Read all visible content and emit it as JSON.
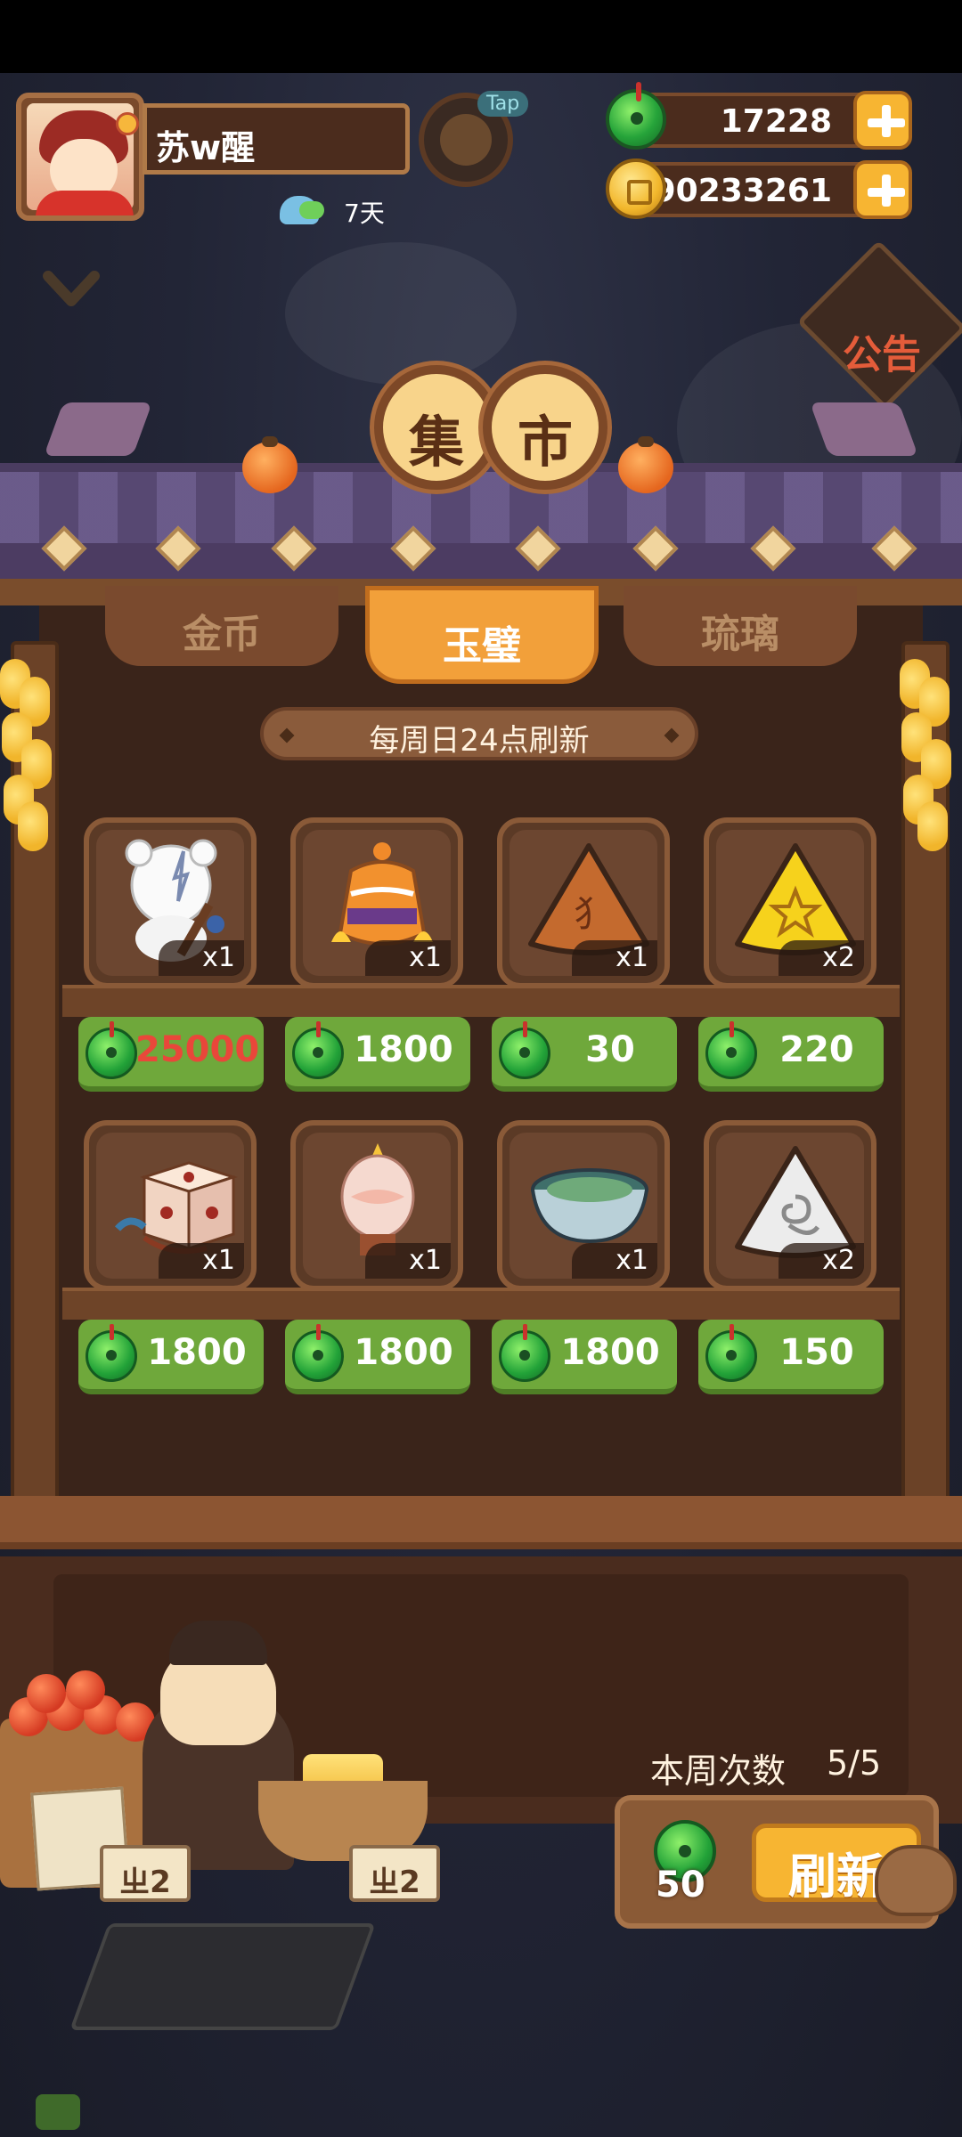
{
  "player": {
    "name": "苏w醒",
    "days": "7天",
    "tap_label": "Tap"
  },
  "currency": {
    "jade": "17228",
    "coins": "90233261"
  },
  "notice": {
    "label": "公告"
  },
  "market": {
    "title_chars": [
      "集",
      "市"
    ],
    "tabs": [
      {
        "label": "金币",
        "active": false
      },
      {
        "label": "玉璧",
        "active": true
      },
      {
        "label": "琉璃",
        "active": false
      }
    ],
    "refresh_note": "每周日24点刷新",
    "items": [
      {
        "icon": "bear-musician-icon",
        "qty": "x1",
        "price": "25000",
        "price_color": "#e9473a"
      },
      {
        "icon": "ornate-jar-icon",
        "qty": "x1",
        "price": "1800"
      },
      {
        "icon": "copper-rice-dumpling-icon",
        "qty": "x1",
        "price": "30"
      },
      {
        "icon": "gold-star-dumpling-icon",
        "qty": "x2",
        "price": "220"
      },
      {
        "icon": "dice-block-icon",
        "qty": "x1",
        "price": "1800"
      },
      {
        "icon": "lantern-icon",
        "qty": "x1",
        "price": "1800"
      },
      {
        "icon": "jade-bowl-icon",
        "qty": "x1",
        "price": "1800"
      },
      {
        "icon": "silver-swirl-dumpling-icon",
        "qty": "x2",
        "price": "150"
      }
    ]
  },
  "scene": {
    "sign_left": "ㄓ2",
    "sign_right": "ㄓ2"
  },
  "weekly": {
    "label": "本周次数",
    "count": "5/5",
    "refresh_cost": "50",
    "refresh_label": "刷新"
  },
  "colors": {
    "price_green": "#6fa83b",
    "tab_active": "#f2a03a",
    "accent_gold": "#f7b532"
  }
}
